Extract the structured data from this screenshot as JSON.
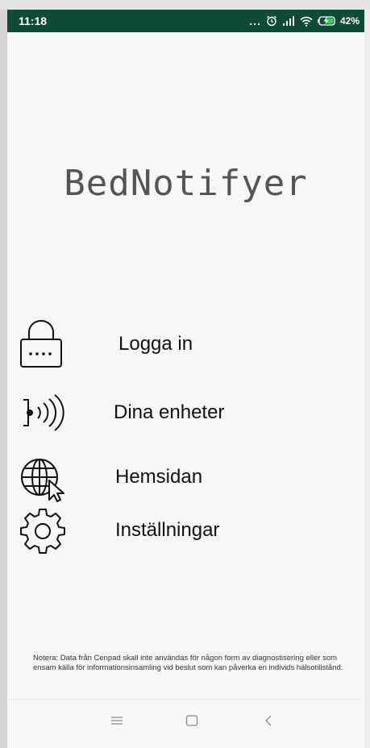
{
  "status_bar": {
    "time": "11:18",
    "more_dots": "...",
    "battery": "42%",
    "background": "#0e4c39"
  },
  "app": {
    "title": "BedNotifyer"
  },
  "menu": {
    "items": [
      {
        "label": "Logga in",
        "icon": "lock-icon"
      },
      {
        "label": "Dina enheter",
        "icon": "signal-waves-icon"
      },
      {
        "label": "Hemsidan",
        "icon": "globe-cursor-icon"
      },
      {
        "label": "Inställningar",
        "icon": "gear-icon"
      }
    ]
  },
  "disclaimer": "Notera: Data från Cenpad skall inte användas för någon form av diagnostisering eller som ensam källa för informationsinsamling vid beslut som kan påverka en individs hälsotillstånd.",
  "nav_bar": {
    "buttons": [
      "menu-icon",
      "home-icon",
      "back-icon"
    ]
  }
}
